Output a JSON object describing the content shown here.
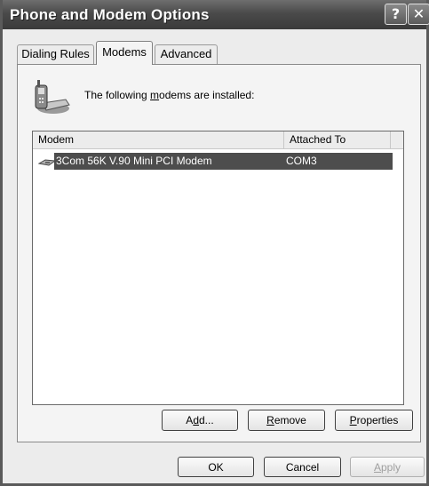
{
  "window": {
    "title": "Phone and Modem Options",
    "help_glyph": "?",
    "close_glyph": "✕"
  },
  "tabs": [
    {
      "label": "Dialing Rules",
      "selected": false
    },
    {
      "label": "Modems",
      "selected": true
    },
    {
      "label": "Advanced",
      "selected": false
    }
  ],
  "intro": {
    "pre": "The following ",
    "accel": "m",
    "post": "odems are  installed:",
    "icon": "phone-modem-icon"
  },
  "modem_list": {
    "columns": [
      "Modem",
      "Attached To"
    ],
    "rows": [
      {
        "modem": "3Com 56K V.90 Mini PCI Modem",
        "attached_to": "COM3",
        "selected": true,
        "icon": "modem-icon"
      }
    ]
  },
  "list_buttons": {
    "add": {
      "pre": "A",
      "accel": "d",
      "post": "d..."
    },
    "remove": {
      "pre": "",
      "accel": "R",
      "post": "emove"
    },
    "properties": {
      "pre": "",
      "accel": "P",
      "post": "roperties"
    }
  },
  "dialog_buttons": {
    "ok": "OK",
    "cancel": "Cancel",
    "apply": {
      "pre": "",
      "accel": "A",
      "post": "pply",
      "disabled": true
    }
  },
  "colors": {
    "selection": "#4d4d4d",
    "titlebar": "#4a4a4a"
  }
}
